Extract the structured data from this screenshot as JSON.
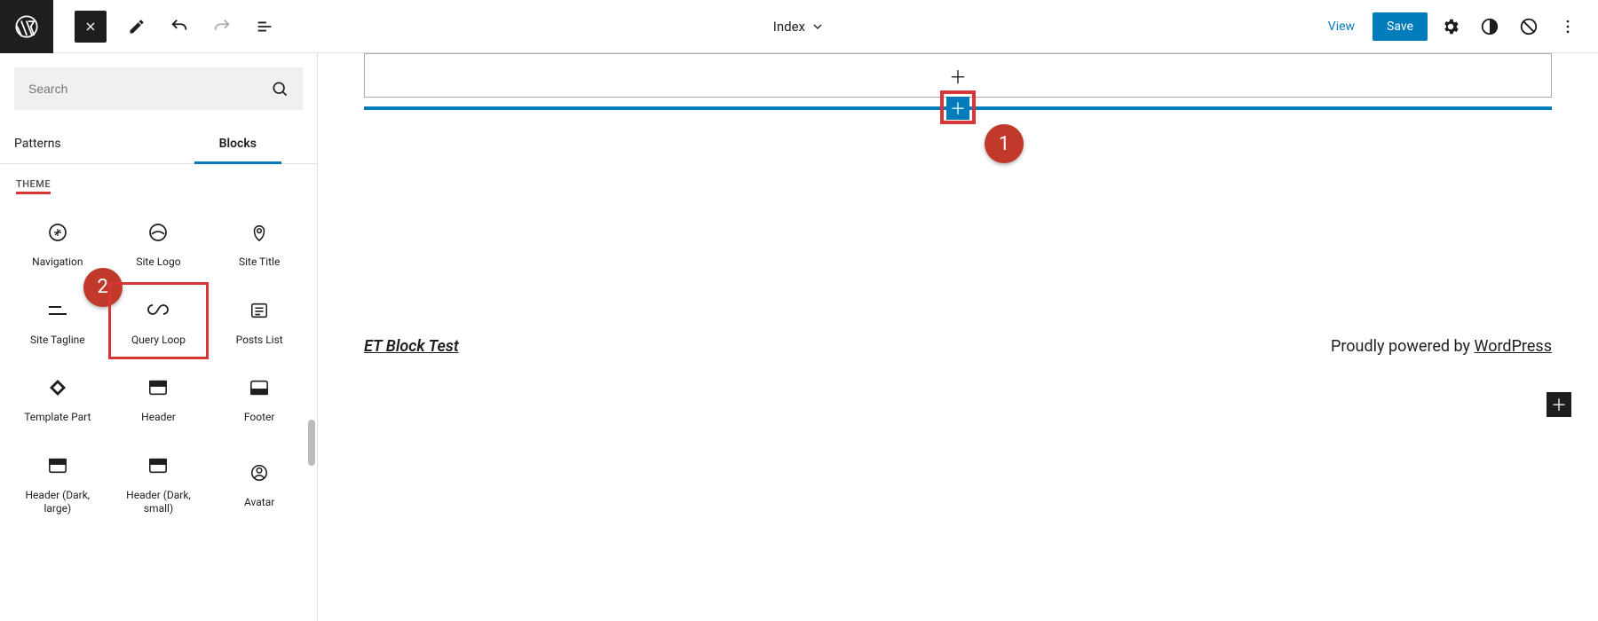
{
  "topbar": {
    "title": "Index",
    "view": "View",
    "save": "Save"
  },
  "sidebar": {
    "search_placeholder": "Search",
    "tabs": {
      "patterns": "Patterns",
      "blocks": "Blocks"
    },
    "section": "THEME",
    "blocks": [
      {
        "label": "Navigation"
      },
      {
        "label": "Site Logo"
      },
      {
        "label": "Site Title"
      },
      {
        "label": "Site Tagline"
      },
      {
        "label": "Query Loop"
      },
      {
        "label": "Posts List"
      },
      {
        "label": "Template Part"
      },
      {
        "label": "Header"
      },
      {
        "label": "Footer"
      },
      {
        "label": "Header (Dark, large)"
      },
      {
        "label": "Header (Dark, small)"
      },
      {
        "label": "Avatar"
      }
    ]
  },
  "canvas": {
    "footer_site": "ET Block Test",
    "footer_powered_prefix": "Proudly powered by ",
    "footer_powered_link": "WordPress"
  },
  "callouts": {
    "one": "1",
    "two": "2"
  },
  "colors": {
    "accent": "#007cba",
    "red": "#d63638",
    "callout": "#c0392b"
  }
}
